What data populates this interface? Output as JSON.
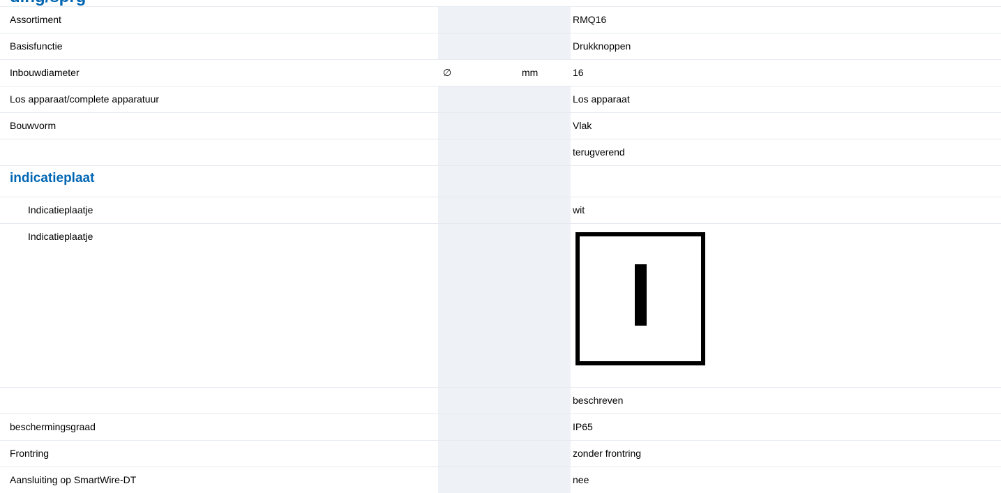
{
  "header": {
    "partial_heading": "ding/sprg"
  },
  "rows": [
    {
      "label": "Assortiment",
      "symbol": "",
      "unit": "",
      "value": "RMQ16"
    },
    {
      "label": "Basisfunctie",
      "symbol": "",
      "unit": "",
      "value": "Drukknoppen"
    },
    {
      "label": "Inbouwdiameter",
      "symbol": "∅",
      "unit": "mm",
      "value": "16"
    },
    {
      "label": "Los apparaat/complete apparatuur",
      "symbol": "",
      "unit": "",
      "value": "Los apparaat"
    },
    {
      "label": "Bouwvorm",
      "symbol": "",
      "unit": "",
      "value": "Vlak"
    },
    {
      "label": "",
      "symbol": "",
      "unit": "",
      "value": "terugverend"
    }
  ],
  "section": {
    "title": "indicatieplaat",
    "rows": [
      {
        "label": "Indicatieplaatje",
        "value": "wit"
      },
      {
        "label": "Indicatieplaatje",
        "value": "",
        "image": "indicator-plate-I-symbol-icon"
      }
    ]
  },
  "rows_after": [
    {
      "label": "",
      "symbol": "",
      "unit": "",
      "value": "beschreven"
    },
    {
      "label": "beschermingsgraad",
      "symbol": "",
      "unit": "",
      "value": "IP65"
    },
    {
      "label": "Frontring",
      "symbol": "",
      "unit": "",
      "value": "zonder frontring"
    },
    {
      "label": "Aansluiting op SmartWire-DT",
      "symbol": "",
      "unit": "",
      "value": "nee"
    }
  ],
  "colors": {
    "heading": "#0066b3",
    "column_shading": "#eef1f6",
    "divider": "#e6e9ef"
  }
}
